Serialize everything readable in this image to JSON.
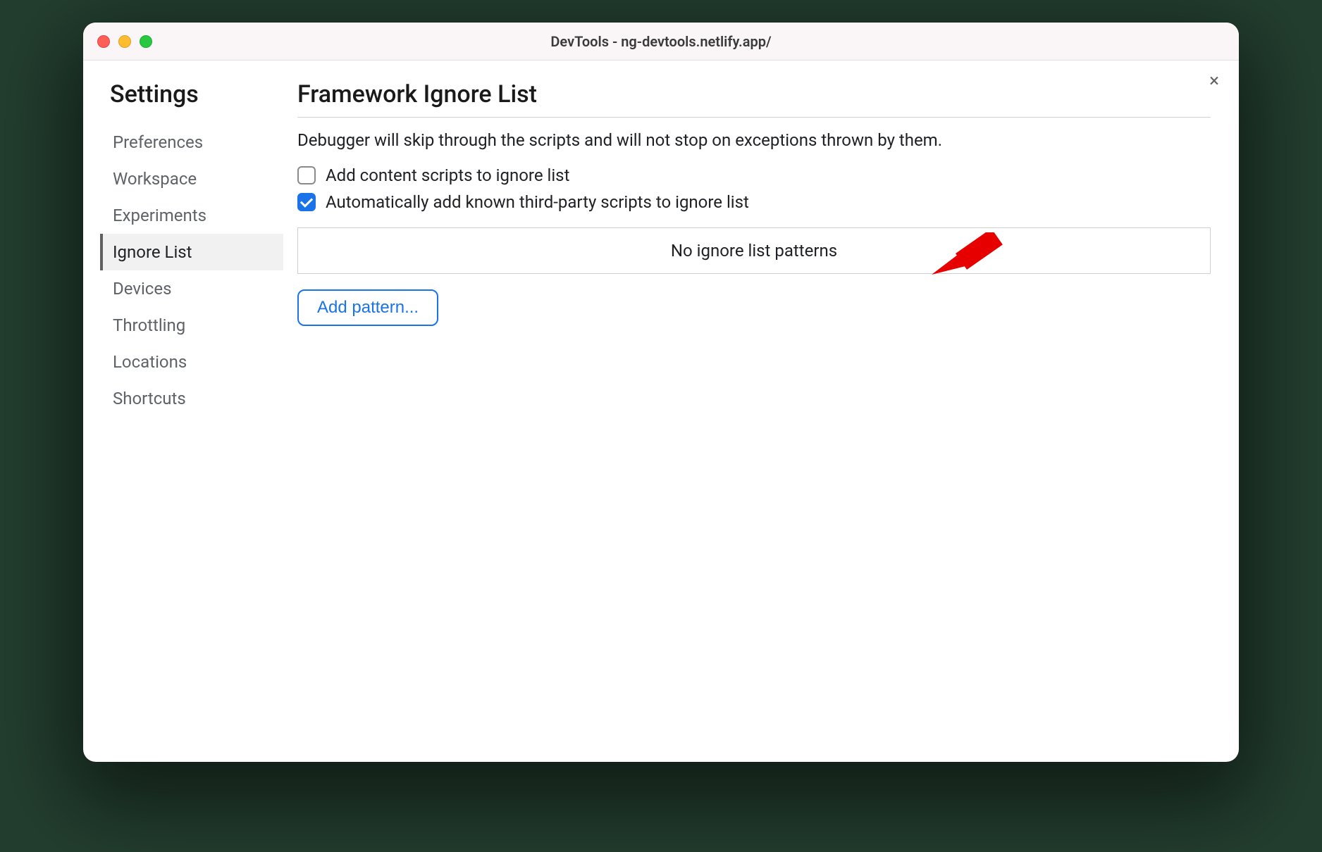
{
  "window": {
    "title": "DevTools - ng-devtools.netlify.app/"
  },
  "sidebar": {
    "heading": "Settings",
    "items": [
      {
        "label": "Preferences",
        "active": false
      },
      {
        "label": "Workspace",
        "active": false
      },
      {
        "label": "Experiments",
        "active": false
      },
      {
        "label": "Ignore List",
        "active": true
      },
      {
        "label": "Devices",
        "active": false
      },
      {
        "label": "Throttling",
        "active": false
      },
      {
        "label": "Locations",
        "active": false
      },
      {
        "label": "Shortcuts",
        "active": false
      }
    ]
  },
  "main": {
    "heading": "Framework Ignore List",
    "description": "Debugger will skip through the scripts and will not stop on exceptions thrown by them.",
    "checks": [
      {
        "label": "Add content scripts to ignore list",
        "checked": false
      },
      {
        "label": "Automatically add known third-party scripts to ignore list",
        "checked": true
      }
    ],
    "patternsEmpty": "No ignore list patterns",
    "addPatternLabel": "Add pattern..."
  },
  "closeLabel": "×"
}
